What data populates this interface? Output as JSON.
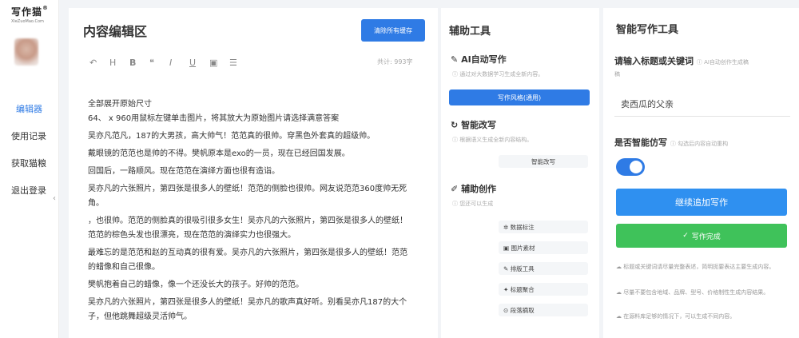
{
  "sidebar": {
    "logo_title": "写作猫",
    "logo_reg": "®",
    "logo_sub": "XieZuoMao.Com",
    "items": [
      {
        "label": "编辑器"
      },
      {
        "label": "使用记录"
      },
      {
        "label": "获取猫粮"
      },
      {
        "label": "退出登录"
      }
    ],
    "collapse_glyph": "‹"
  },
  "editor": {
    "title": "内容编辑区",
    "clear_button": "清除所有缓存",
    "word_count": "共计: 993字",
    "toolbar": [
      "↶",
      "H",
      "B",
      "❝",
      "I",
      "U",
      "▣",
      "☰"
    ],
    "paragraphs": [
      "全部展开原始尺寸",
      "64、 x 960用鼠标左键单击图片，将其放大为原始图片请选择满意答案",
      "吴亦凡范凡，187的大男孩，高大帅气！范范真的很帅。穿黑色外套真的超级帅。",
      "戴眼镜的范范也是帅的不得。樊帆原本是exo的一员，现在已经回国发展。",
      "回国后，一路顺风。现在范范在演绎方面也很有造诣。",
      "吴亦凡的六张照片，第四张是很多人的壁纸！范范的侧脸也很帅。网友说范范360度帅无死角。",
      "，也很帅。范范的侧脸真的很吸引很多女生！吴亦凡的六张照片，第四张是很多人的壁纸！范范的棕色头发也很漂亮，现在范范的演绎实力也很强大。",
      "最难忘的是范范和赵的互动真的很有爱。吴亦凡的六张照片，第四张是很多人的壁纸！范范的蜡像和自己很像。",
      "樊帆抱着自己的蜡像，像一个还没长大的孩子。好帅的范范。",
      "吴亦凡的六张照片，第四张是很多人的壁纸！吴亦凡的歌声真好听。别看吴亦凡187的大个子，但他跳舞超级灵活帅气。"
    ]
  },
  "aux": {
    "title": "辅助工具",
    "ai_write": {
      "title": "AI自动写作",
      "desc": "ⓘ 通过对大数据学习生成全新内容。",
      "button": "写作风格(通用)"
    },
    "rewrite": {
      "title": "智能改写",
      "desc": "ⓘ 根据语义生成全新内容结构。",
      "button": "智能改写"
    },
    "assist": {
      "title": "辅助创作",
      "desc": "ⓘ 您还可以生成",
      "buttons": [
        "✲ 数据标注",
        "▣ 图片素材",
        "✎ 排版工具",
        "✦ 标题聚合",
        "⊙ 段落摘取"
      ]
    }
  },
  "smart": {
    "title": "智能写作工具",
    "keyword_label": "请输入标题或关键词",
    "keyword_hint": "ⓘ AI自动创作生成稿",
    "keyword_hint2": "稿",
    "keyword_value": "卖西瓜的父亲",
    "imitate_label": "是否智能仿写",
    "imitate_hint": "ⓘ 勾选后内容自动重构",
    "toggle_on": true,
    "continue_button": "继续追加写作",
    "done_button": "写作完成",
    "done_icon": "✓",
    "notes": [
      "☁ 标题或关键词请尽量完整表述，简明扼要表达主要生成内容。",
      "☁ 尽量不要包含地域、品牌、型号、价格制性生成内容结果。",
      "☁ 在源料库足够的情况下，可以生成不同内容。"
    ]
  }
}
